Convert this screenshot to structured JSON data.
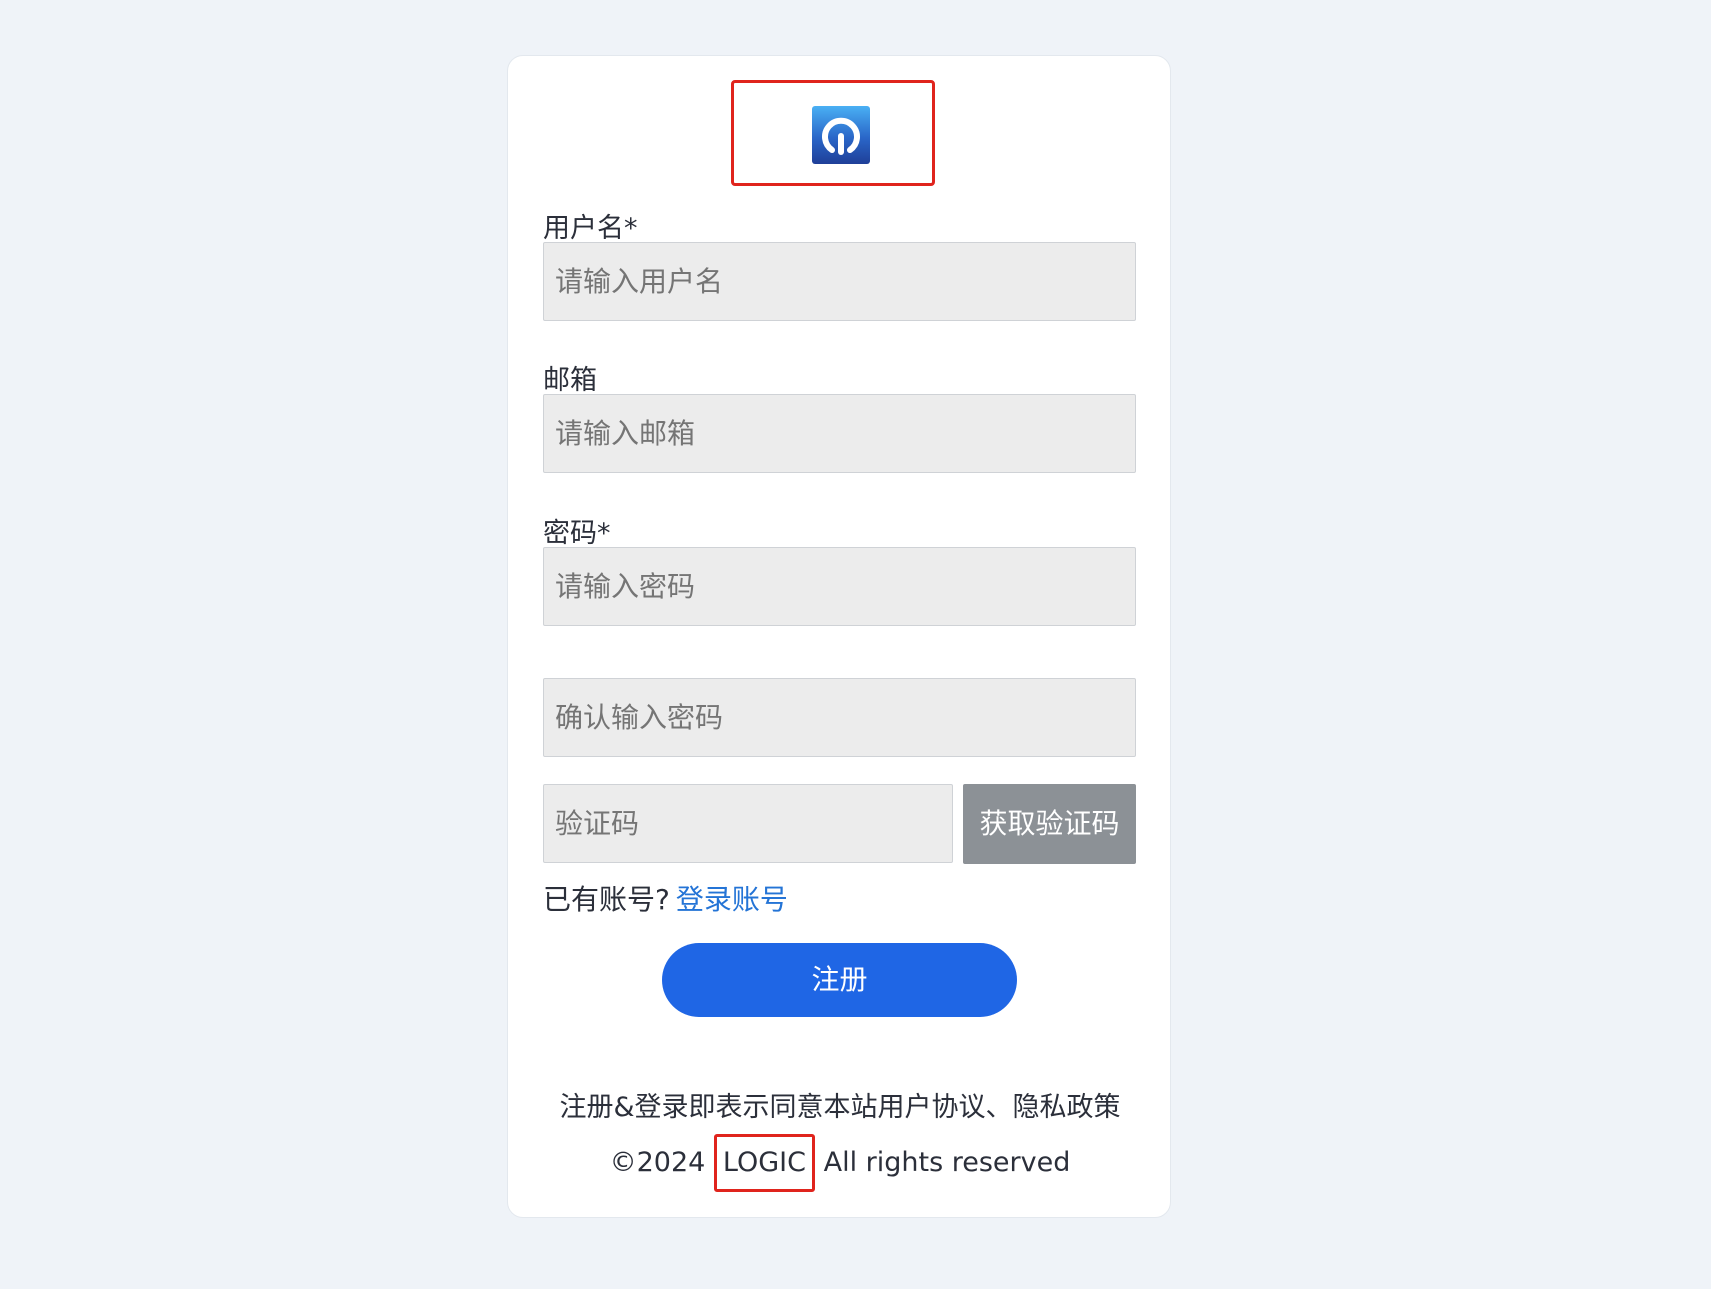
{
  "logo": {
    "icon": "power-logo-icon",
    "highlight_color": "#e0241d"
  },
  "form": {
    "username": {
      "label": "用户名*",
      "placeholder": "请输入用户名"
    },
    "email": {
      "label": "邮箱",
      "placeholder": "请输入邮箱"
    },
    "password": {
      "label": "密码*",
      "placeholder": "请输入密码"
    },
    "confirm_password": {
      "placeholder": "确认输入密码"
    },
    "captcha": {
      "placeholder": "验证码",
      "button_label": "获取验证码"
    }
  },
  "login_prompt": {
    "text": "已有账号?",
    "link_label": "登录账号"
  },
  "submit": {
    "label": "注册"
  },
  "footer": {
    "agreement_text": "注册&登录即表示同意本站用户协议、隐私政策",
    "copyright_prefix": "©2024",
    "brand": "LOGIC",
    "copyright_suffix": "All rights reserved"
  },
  "colors": {
    "page_background": "#eff3f8",
    "card_background": "#ffffff",
    "primary_button": "#1f66e5",
    "link": "#2474d6",
    "disabled_button": "#8c9196",
    "input_background": "#ececec"
  }
}
